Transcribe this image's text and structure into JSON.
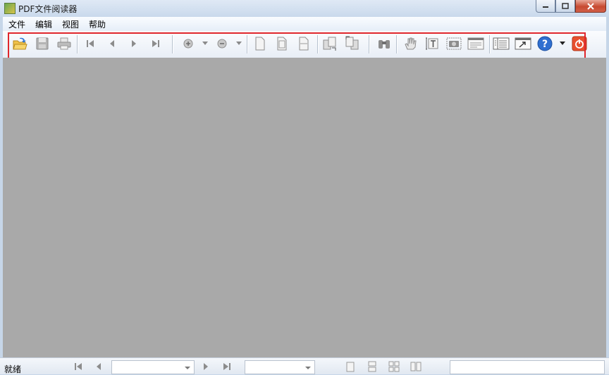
{
  "window": {
    "title": "PDF文件阅读器"
  },
  "menu": [
    "文件",
    "编辑",
    "视图",
    "帮助"
  ],
  "toolbar": {
    "buttons": [
      "open-icon",
      "save-icon",
      "print-icon",
      "first-page-icon",
      "prev-page-icon",
      "next-page-icon",
      "last-page-icon",
      "zoom-in-icon",
      "zoom-out-icon",
      "actual-size-icon",
      "fit-page-icon",
      "fit-width-icon",
      "rotate-cw-icon",
      "rotate-ccw-icon",
      "find-icon",
      "hand-icon",
      "select-text-icon",
      "snapshot-icon",
      "form-icon",
      "outline-icon",
      "fullscreen-icon",
      "help-icon",
      "exit-icon"
    ],
    "highlight_color": "#e0262c"
  },
  "document_area": {
    "background": "#a9a9a9"
  },
  "status": {
    "text": "就绪",
    "page_combo_value": "",
    "zoom_combo_value": ""
  }
}
